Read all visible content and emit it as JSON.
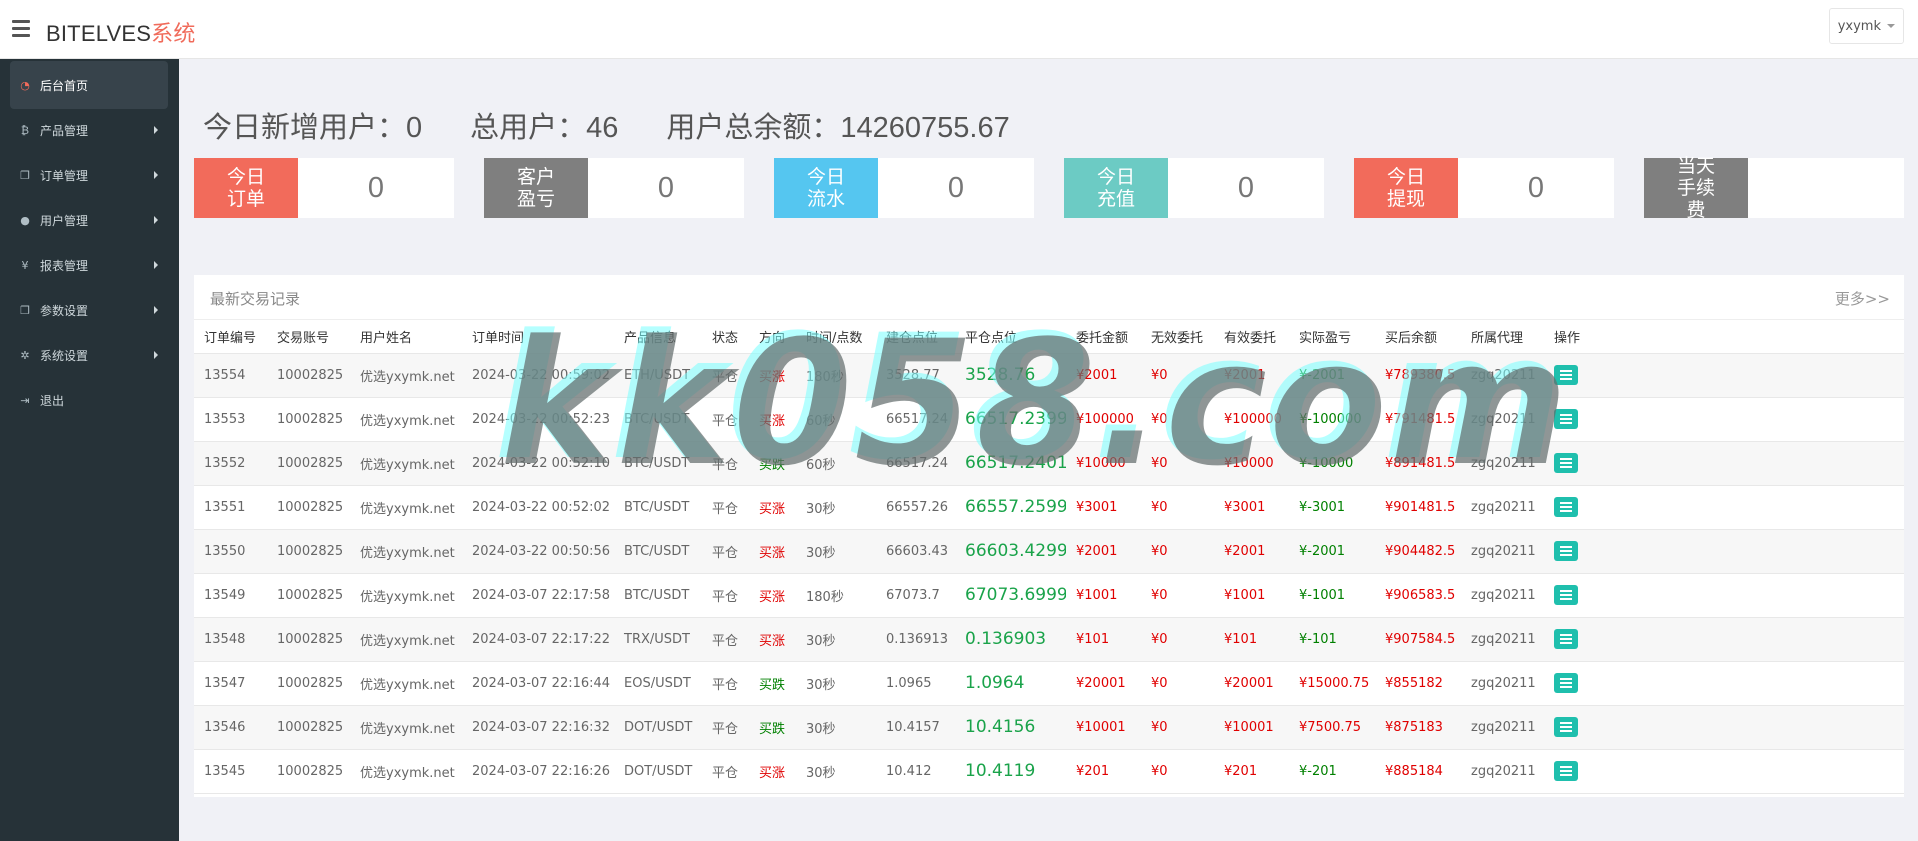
{
  "header": {
    "brand_main": "BITELVES",
    "brand_accent": "系统",
    "user": "yxymk"
  },
  "sidebar": {
    "items": [
      {
        "label": "后台首页",
        "icon": "dashboard-icon",
        "active": true
      },
      {
        "label": "产品管理",
        "icon": "bitcoin-icon"
      },
      {
        "label": "订单管理",
        "icon": "copy-icon"
      },
      {
        "label": "用户管理",
        "icon": "user-icon"
      },
      {
        "label": "报表管理",
        "icon": "yen-icon"
      },
      {
        "label": "参数设置",
        "icon": "copy-icon"
      },
      {
        "label": "系统设置",
        "icon": "gears-icon"
      },
      {
        "label": "退出",
        "icon": "sign-out-icon"
      }
    ]
  },
  "stats": {
    "new_users": "今日新增用户：0",
    "total_users": "总用户：46",
    "total_balance": "用户总余额：14260755.67"
  },
  "cards": [
    {
      "label": "今日订单",
      "value": "0",
      "color": "#f26b5b"
    },
    {
      "label": "客户盈亏",
      "value": "0",
      "color": "#7f7f7f"
    },
    {
      "label": "今日流水",
      "value": "0",
      "color": "#55c6f0"
    },
    {
      "label": "今日充值",
      "value": "0",
      "color": "#6ccbc4"
    },
    {
      "label": "今日提现",
      "value": "0",
      "color": "#f26b5b"
    },
    {
      "label": "当天手续费",
      "value": "",
      "color": "#7f7f7f"
    }
  ],
  "panel": {
    "title": "最新交易记录",
    "more": "更多>>"
  },
  "table": {
    "headers": [
      "订单编号",
      "交易账号",
      "用户姓名",
      "订单时间",
      "产品信息",
      "状态",
      "方向",
      "时间/点数",
      "建仓点位",
      "平仓点位",
      "委托金额",
      "无效委托",
      "有效委托",
      "实际盈亏",
      "买后余额",
      "所属代理",
      "操作"
    ],
    "rows": [
      [
        "13554",
        "10002825",
        "优选yxymk.net",
        "2024-03-22 00:59:02",
        "ETH/USDT",
        "平仓",
        "买涨",
        "180秒",
        "3528.77",
        "3528.76",
        "¥2001",
        "¥0",
        "¥2001",
        "¥-2001",
        "¥789380.5",
        "zgq20211"
      ],
      [
        "13553",
        "10002825",
        "优选yxymk.net",
        "2024-03-22 00:52:23",
        "BTC/USDT",
        "平仓",
        "买涨",
        "60秒",
        "66517.24",
        "66517.2399",
        "¥100000",
        "¥0",
        "¥100000",
        "¥-100000",
        "¥791481.5",
        "zgq20211"
      ],
      [
        "13552",
        "10002825",
        "优选yxymk.net",
        "2024-03-22 00:52:10",
        "BTC/USDT",
        "平仓",
        "买跌",
        "60秒",
        "66517.24",
        "66517.2401",
        "¥10000",
        "¥0",
        "¥10000",
        "¥-10000",
        "¥891481.5",
        "zgq20211"
      ],
      [
        "13551",
        "10002825",
        "优选yxymk.net",
        "2024-03-22 00:52:02",
        "BTC/USDT",
        "平仓",
        "买涨",
        "30秒",
        "66557.26",
        "66557.2599",
        "¥3001",
        "¥0",
        "¥3001",
        "¥-3001",
        "¥901481.5",
        "zgq20211"
      ],
      [
        "13550",
        "10002825",
        "优选yxymk.net",
        "2024-03-22 00:50:56",
        "BTC/USDT",
        "平仓",
        "买涨",
        "30秒",
        "66603.43",
        "66603.4299",
        "¥2001",
        "¥0",
        "¥2001",
        "¥-2001",
        "¥904482.5",
        "zgq20211"
      ],
      [
        "13549",
        "10002825",
        "优选yxymk.net",
        "2024-03-07 22:17:58",
        "BTC/USDT",
        "平仓",
        "买涨",
        "180秒",
        "67073.7",
        "67073.6999",
        "¥1001",
        "¥0",
        "¥1001",
        "¥-1001",
        "¥906583.5",
        "zgq20211"
      ],
      [
        "13548",
        "10002825",
        "优选yxymk.net",
        "2024-03-07 22:17:22",
        "TRX/USDT",
        "平仓",
        "买涨",
        "30秒",
        "0.136913",
        "0.136903",
        "¥101",
        "¥0",
        "¥101",
        "¥-101",
        "¥907584.5",
        "zgq20211"
      ],
      [
        "13547",
        "10002825",
        "优选yxymk.net",
        "2024-03-07 22:16:44",
        "EOS/USDT",
        "平仓",
        "买跌",
        "30秒",
        "1.0965",
        "1.0964",
        "¥20001",
        "¥0",
        "¥20001",
        "¥15000.75",
        "¥855182",
        "zgq20211"
      ],
      [
        "13546",
        "10002825",
        "优选yxymk.net",
        "2024-03-07 22:16:32",
        "DOT/USDT",
        "平仓",
        "买跌",
        "30秒",
        "10.4157",
        "10.4156",
        "¥10001",
        "¥0",
        "¥10001",
        "¥7500.75",
        "¥875183",
        "zgq20211"
      ],
      [
        "13545",
        "10002825",
        "优选yxymk.net",
        "2024-03-07 22:16:26",
        "DOT/USDT",
        "平仓",
        "买涨",
        "30秒",
        "10.412",
        "10.4119",
        "¥201",
        "¥0",
        "¥201",
        "¥-201",
        "¥885184",
        "zgq20211"
      ]
    ]
  },
  "watermark": "kk058.com"
}
